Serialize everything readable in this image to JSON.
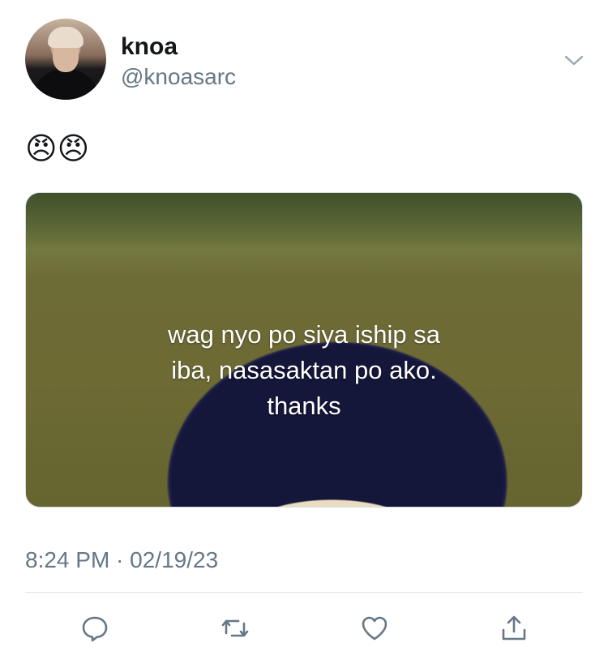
{
  "user": {
    "name": "knoa",
    "handle": "@knoasarc"
  },
  "tweet": {
    "text": "😠😠",
    "media_caption": {
      "line1": "wag nyo po siya iship sa",
      "line2": "iba, nasasaktan po ako.",
      "line3": "thanks"
    },
    "timestamp": "8:24 PM · 02/19/23"
  },
  "actions": {
    "reply_icon": "reply-icon",
    "retweet_icon": "retweet-icon",
    "like_icon": "heart-icon",
    "share_icon": "share-icon"
  },
  "colors": {
    "icon": "#657786",
    "text_primary": "#14171a",
    "text_secondary": "#657786"
  }
}
